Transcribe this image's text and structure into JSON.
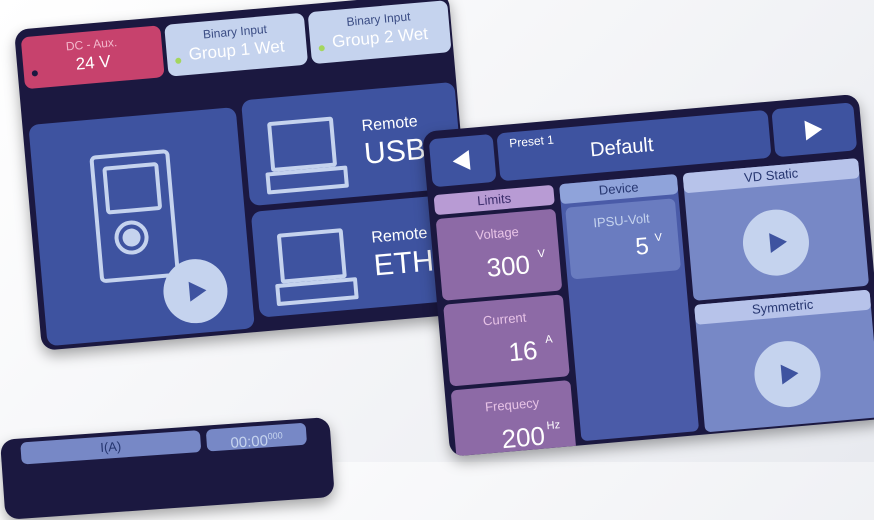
{
  "colors": {
    "screen_bg": "#1b1840",
    "tile": "#3e53a0",
    "pink": "#c7426d",
    "light_blue": "#c5d3ee",
    "purple": "#8d6aa6",
    "green_dot": "#a4d65e"
  },
  "main_screen": {
    "tabs": [
      {
        "line1": "DC - Aux.",
        "line2": "24 V",
        "active": true
      },
      {
        "line1": "Binary Input",
        "line2": "Group 1 Wet"
      },
      {
        "line1": "Binary Input",
        "line2": "Group 2 Wet"
      }
    ],
    "remote_usb": {
      "label": "Remote",
      "name": "USB"
    },
    "remote_eth": {
      "label": "Remote",
      "name": "ETH"
    }
  },
  "preset_screen": {
    "preset_label": "Preset 1",
    "preset_name": "Default",
    "columns": {
      "limits": "Limits",
      "device": "Device",
      "vd_static": "VD Static",
      "symmetric": "Symmetric"
    },
    "limits": [
      {
        "label": "Voltage",
        "value": "300",
        "unit": "V"
      },
      {
        "label": "Current",
        "value": "16",
        "unit": "A"
      },
      {
        "label": "Frequecy",
        "value": "200",
        "unit": "Hz"
      }
    ],
    "device": {
      "label": "IPSU-Volt",
      "value": "5",
      "unit": "V"
    }
  },
  "bottom_screen": {
    "tab_label": "I(A)",
    "timer": "00:00",
    "timer_ms": "000"
  }
}
